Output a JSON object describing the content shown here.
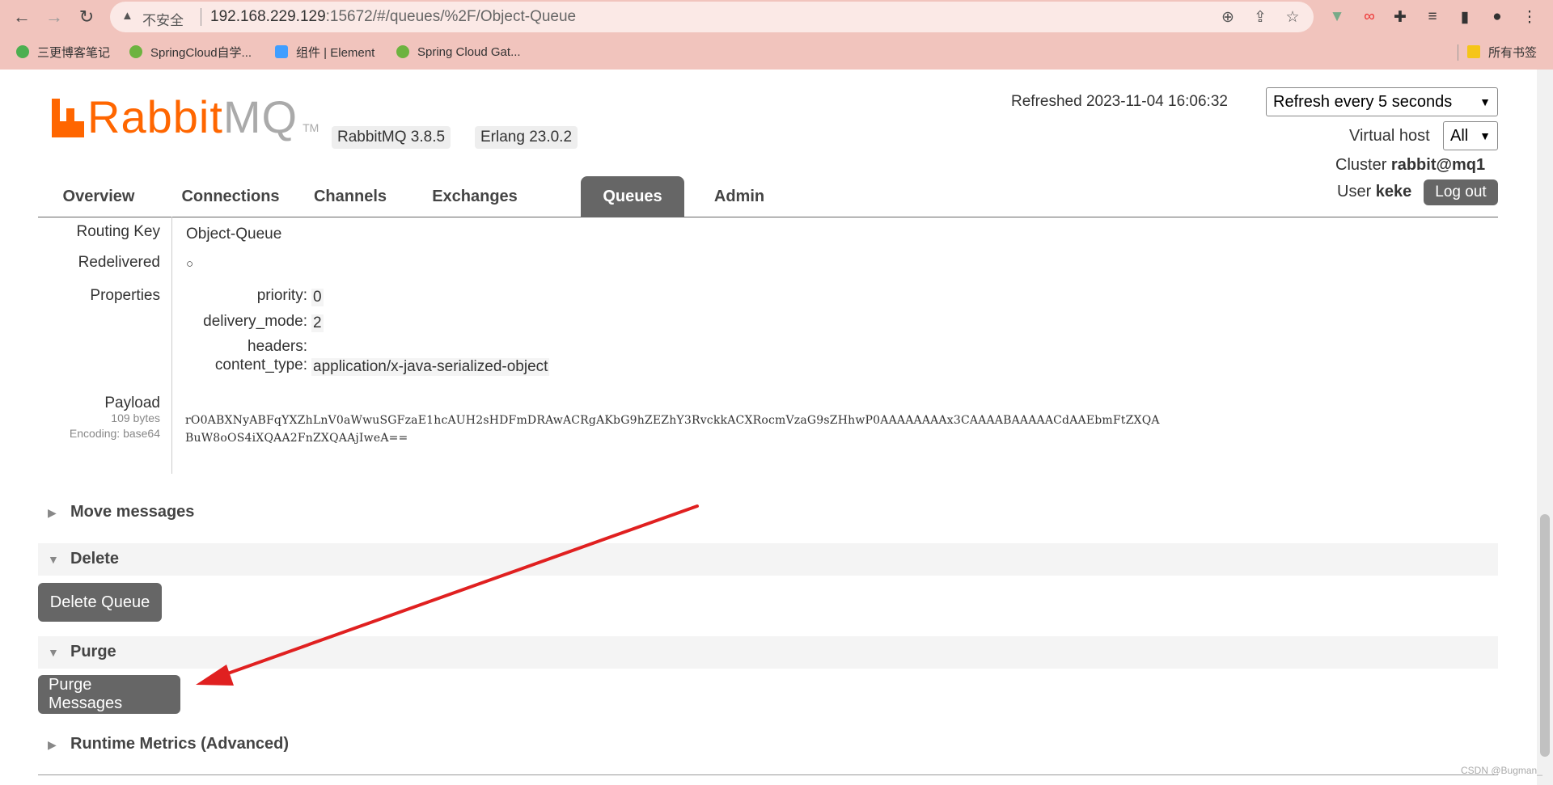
{
  "browser": {
    "security_label": "不安全",
    "url_host": "192.168.229.129",
    "url_rest": ":15672/#/queues/%2F/Object-Queue",
    "bookmarks": [
      {
        "label": "三更博客笔记",
        "color": "#4caf50"
      },
      {
        "label": "SpringCloud自学...",
        "color": "#6db33f"
      },
      {
        "label": "组件 | Element",
        "color": "#409eff"
      },
      {
        "label": "Spring Cloud Gat...",
        "color": "#6db33f"
      }
    ],
    "all_bookmarks_label": "所有书签"
  },
  "header": {
    "logo_rabbit": "Rabbit",
    "logo_mq": "MQ",
    "logo_tm": "TM",
    "rabbitmq_version": "RabbitMQ 3.8.5",
    "erlang_version": "Erlang 23.0.2",
    "refreshed_text": "Refreshed 2023-11-04 16:06:32",
    "refresh_select": "Refresh every 5 seconds",
    "virtual_host_label": "Virtual host",
    "virtual_host_value": "All",
    "cluster_label": "Cluster",
    "cluster_name": "rabbit@mq1",
    "user_label": "User",
    "user_name": "keke",
    "logout_label": "Log out"
  },
  "tabs": [
    {
      "label": "Overview",
      "active": false
    },
    {
      "label": "Connections",
      "active": false
    },
    {
      "label": "Channels",
      "active": false
    },
    {
      "label": "Exchanges",
      "active": false
    },
    {
      "label": "Queues",
      "active": true
    },
    {
      "label": "Admin",
      "active": false
    }
  ],
  "message": {
    "routing_key_label": "Routing Key",
    "routing_key": "Object-Queue",
    "redelivered_label": "Redelivered",
    "redelivered_value": "○",
    "properties_label": "Properties",
    "properties": [
      {
        "key": "priority:",
        "value": "0"
      },
      {
        "key": "delivery_mode:",
        "value": "2"
      },
      {
        "key": "headers:",
        "value": ""
      },
      {
        "key": "content_type:",
        "value": "application/x-java-serialized-object"
      }
    ],
    "payload_label": "Payload",
    "payload_size": "109 bytes",
    "payload_encoding": "Encoding: base64",
    "payload_line1": "rO0ABXNyABFqYXZhLnV0aWwuSGFzaE1hcAUH2sHDFmDRAwACRgAKbG9hZEZhY3RvckkACXRocmVzaG9sZHhwP0AAAAAAAAx3CAAAABAAAAACdAAEbmFtZXQA",
    "payload_line2": "BuW8oOS4iXQAA2FnZXQAAjIweA=="
  },
  "sections": {
    "move_messages": "Move messages",
    "delete": "Delete",
    "delete_queue_button": "Delete Queue",
    "purge": "Purge",
    "purge_messages_button": "Purge Messages",
    "runtime_metrics": "Runtime Metrics (Advanced)"
  },
  "watermark": "CSDN @Bugman_",
  "colors": {
    "brand_orange": "#ff6600",
    "chrome_bg": "#f1c4bd",
    "button_gray": "#666666",
    "annotation_arrow": "#e02020"
  }
}
